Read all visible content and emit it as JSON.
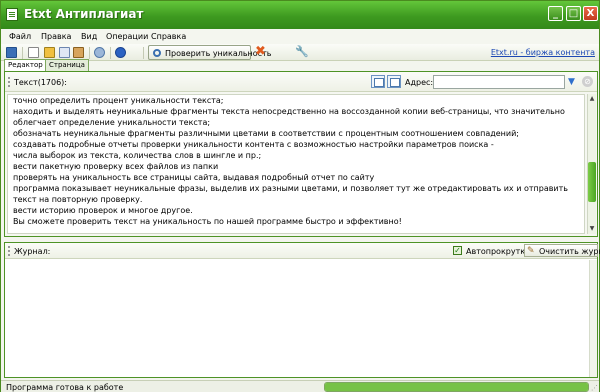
{
  "window": {
    "title": "Etxt Антиплагиат",
    "min": "_",
    "max": "□",
    "close": "X"
  },
  "menu": [
    "Файл",
    "Правка",
    "Вид",
    "Операции",
    "Справка"
  ],
  "toolbar": {
    "check_label": "Проверить уникальность",
    "link": "Etxt.ru - биржа контента"
  },
  "tabs": [
    "Редактор",
    "Страница"
  ],
  "editor": {
    "count_label": "Текст(1706):",
    "address_label": "Адрес:",
    "address_value": "",
    "lines": [
      "точно определить процент уникальности текста;",
      "находить и выделять неуникальные фрагменты текста непосредственно на воссозданной копии веб-страницы, что значительно",
      "облегчает определение уникальности текста;",
      "обозначать неуникальные фрагменты различными цветами в соответствии с процентным соотношением совпадений;",
      "создавать подробные отчеты проверки уникальности контента с возможностью настройки параметров поиска -",
      "числа выборок из текста, количества слов в шингле и пр.;",
      "вести пакетную проверку всех файлов из папки",
      "проверять на уникальность все страницы сайта, выдавая подробный отчет по сайту",
      "программа показывает неуникальные фразы, выделив их разными цветами, и позволяет тут же отредактировать их и отправить",
      "текст на повторную проверку.",
      "вести историю проверок и многое другое.",
      "Вы сможете проверить текст на уникальность по нашей программе быстро и эффективно!"
    ]
  },
  "journal": {
    "title": "Журнал:",
    "autoscroll_label": "Автопрокрутка",
    "autoscroll_checked": true,
    "clear_label": "Очистить журнал"
  },
  "status": {
    "text": "Программа готова к работе",
    "progress": 1.0
  },
  "colors": {
    "accent": "#4aa524",
    "title_bar": "#3e9a20",
    "link": "#1c48b4"
  }
}
